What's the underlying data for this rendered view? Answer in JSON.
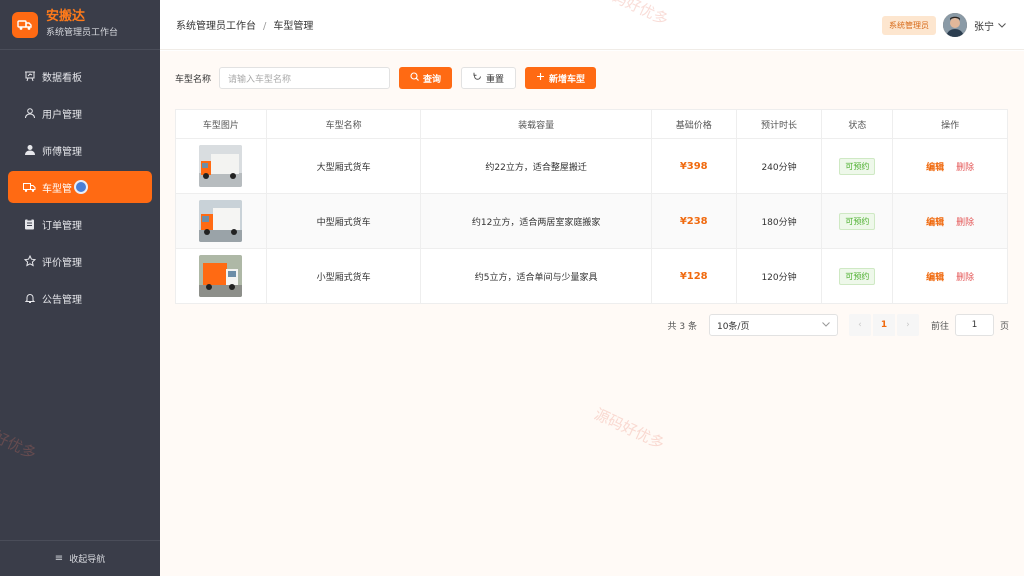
{
  "brand": {
    "title": "安搬达",
    "subtitle": "系统管理员工作台"
  },
  "sidebar": {
    "items": [
      {
        "label": "数据看板",
        "icon": "chart-icon",
        "active": false
      },
      {
        "label": "用户管理",
        "icon": "user-icon",
        "active": false
      },
      {
        "label": "师傅管理",
        "icon": "person-icon",
        "active": false
      },
      {
        "label": "车型管",
        "icon": "truck-icon",
        "active": true
      },
      {
        "label": "订单管理",
        "icon": "clipboard-icon",
        "active": false
      },
      {
        "label": "评价管理",
        "icon": "star-icon",
        "active": false
      },
      {
        "label": "公告管理",
        "icon": "bell-icon",
        "active": false
      }
    ],
    "collapse_label": "收起导航"
  },
  "header": {
    "breadcrumb": [
      "系统管理员工作台",
      "车型管理"
    ],
    "breadcrumb_sep": "/",
    "role_badge": "系统管理员",
    "user_name": "张宁"
  },
  "search": {
    "label": "车型名称",
    "placeholder": "请输入车型名称",
    "query_label": "查询",
    "reset_label": "重置",
    "add_label": "新增车型"
  },
  "table": {
    "headers": [
      "车型图片",
      "车型名称",
      "装载容量",
      "基础价格",
      "预计时长",
      "状态",
      "操作"
    ],
    "rows": [
      {
        "name": "大型厢式货车",
        "capacity": "约22立方，适合整屋搬迁",
        "price": "¥398",
        "duration": "240分钟",
        "status": "可预约",
        "edit": "编辑",
        "delete": "删除"
      },
      {
        "name": "中型厢式货车",
        "capacity": "约12立方，适合两居室家庭搬家",
        "price": "¥238",
        "duration": "180分钟",
        "status": "可预约",
        "edit": "编辑",
        "delete": "删除"
      },
      {
        "name": "小型厢式货车",
        "capacity": "约5立方，适合单间与少量家具",
        "price": "¥128",
        "duration": "120分钟",
        "status": "可预约",
        "edit": "编辑",
        "delete": "删除"
      }
    ]
  },
  "pagination": {
    "total": "共 3 条",
    "page_size": "10条/页",
    "current_page": "1",
    "goto_label": "前往",
    "goto_value": "1",
    "page_unit": "页"
  },
  "watermark": "源码好优多",
  "colors": {
    "accent": "#ff6a13",
    "sidebar_bg": "#3a3d49",
    "danger": "#e45656",
    "success": "#4caf2e"
  }
}
